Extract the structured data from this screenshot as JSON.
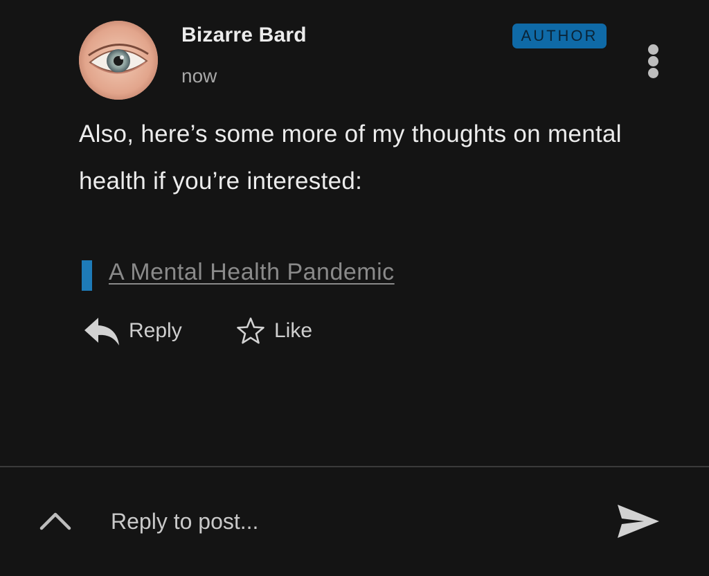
{
  "comment": {
    "author": "Bizarre Bard",
    "timestamp": "now",
    "badge": "AUTHOR",
    "text": "Also, here’s some more of my thoughts on mental health if you’re interested:",
    "link_title": "A Mental Health Pandemic",
    "actions": {
      "reply_label": "Reply",
      "like_label": "Like"
    }
  },
  "composer": {
    "placeholder": "Reply to post..."
  },
  "icons": {
    "avatar": "eye-avatar",
    "menu": "more-vertical-icon",
    "reply": "reply-arrow-icon",
    "like": "star-outline-icon",
    "expand": "chevron-up-icon",
    "send": "send-icon"
  },
  "colors": {
    "background": "#141414",
    "badge": "#0f6aa7",
    "quote_bar": "#1e7bb8",
    "link": "#8a8a8a"
  }
}
